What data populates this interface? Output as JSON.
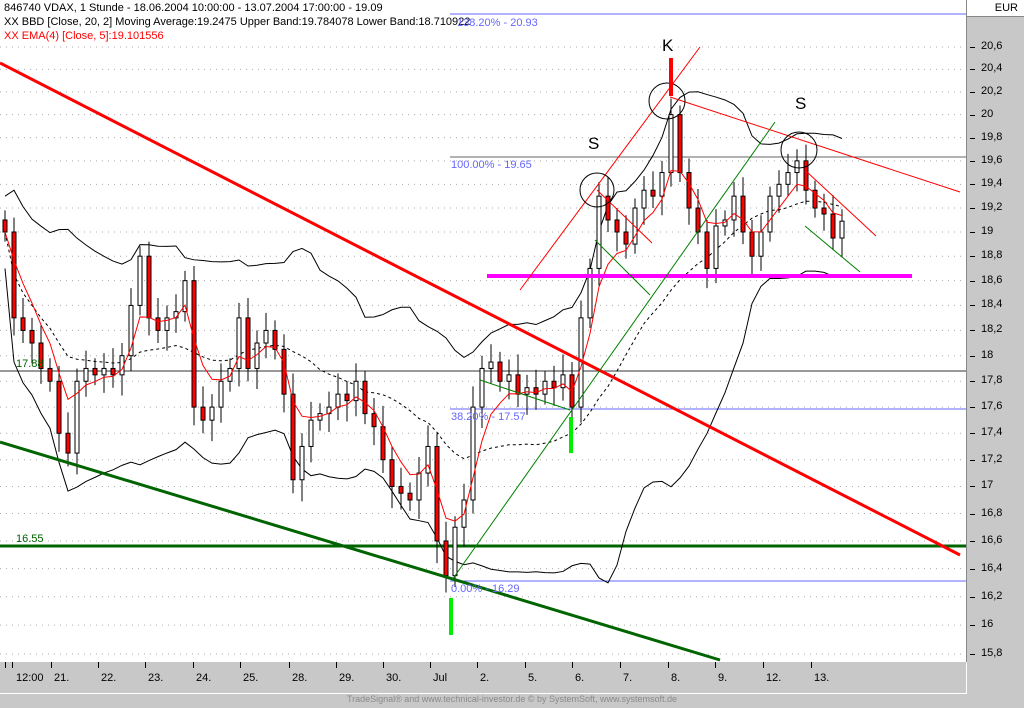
{
  "header": {
    "title_line": "846740  VDAX, 1 Stunde - 18.06.2004 10:00:00 - 13.07.2004 17:00:00 - 19.09",
    "bbd_line": "XX BBD [Close, 20, 2] Moving Average:19.2475 Upper Band:19.784078 Lower Band:18.710922",
    "ema_line": "XX EMA(4) [Close, 5]:19.101556"
  },
  "currency": "EUR",
  "footer": "TradeSignal® and www.technical-investor.de © by SystemSoft, www.systemsoft.de",
  "annotations": {
    "fib_138": "138.20% - 20.93",
    "fib_100": "100.00% - 19.65",
    "fib_38": "38.20% - 17.57",
    "fib_0": "0.00% - 16.29",
    "level_1788": "17.88",
    "level_1655": "16.55",
    "shoulder_left": "S",
    "head": "K",
    "shoulder_right": "S"
  },
  "colors": {
    "candle_down": "#ff0000",
    "candle_up": "#ffffff",
    "ema": "#ff0000",
    "trend_red": "#ff0000",
    "trend_green": "#006400",
    "neckline": "#ff00ff",
    "fib": "#6666ff",
    "marker_green": "#00ee00"
  },
  "chart_data": {
    "type": "candlestick",
    "title": "846740 VDAX, 1 Stunde",
    "scale": "log",
    "ylim": [
      15.75,
      20.75
    ],
    "yticks": [
      "20,6",
      "20,4",
      "20,2",
      "20",
      "19,8",
      "19,6",
      "19,4",
      "19,2",
      "19",
      "18,8",
      "18,6",
      "18,4",
      "18,2",
      "18",
      "17,8",
      "17,6",
      "17,4",
      "17,2",
      "17",
      "16,8",
      "16,6",
      "16,4",
      "16,2",
      "16",
      "15,8"
    ],
    "ytick_values": [
      20.6,
      20.4,
      20.2,
      20,
      19.8,
      19.6,
      19.4,
      19.2,
      19,
      18.8,
      18.6,
      18.4,
      18.2,
      18,
      17.8,
      17.6,
      17.4,
      17.2,
      17,
      16.8,
      16.6,
      16.4,
      16.2,
      16,
      15.8
    ],
    "xticks": [
      "12:00",
      "21.",
      "22.",
      "23.",
      "24.",
      "25.",
      "28.",
      "29.",
      "30.",
      "Jul",
      "2.",
      "5.",
      "6.",
      "7.",
      "8.",
      "9.",
      "12.",
      "13."
    ],
    "close": [
      19.0,
      18.3,
      18.2,
      18.1,
      17.9,
      17.8,
      17.4,
      17.25,
      17.8,
      17.9,
      17.85,
      17.9,
      17.85,
      18.0,
      18.4,
      18.8,
      18.3,
      18.2,
      18.3,
      18.35,
      18.6,
      17.6,
      17.5,
      17.6,
      17.8,
      17.9,
      18.3,
      17.9,
      18.1,
      18.2,
      18.05,
      17.7,
      17.05,
      17.3,
      17.5,
      17.55,
      17.6,
      17.7,
      17.65,
      17.8,
      17.55,
      17.45,
      17.2,
      17.0,
      16.95,
      16.9,
      17.1,
      17.3,
      16.6,
      16.35,
      16.7,
      16.9,
      17.6,
      17.9,
      17.95,
      17.8,
      17.85,
      17.7,
      17.75,
      17.7,
      17.8,
      17.75,
      17.85,
      17.6,
      18.3,
      18.7,
      19.3,
      19.1,
      19.0,
      18.9,
      19.2,
      19.35,
      19.3,
      19.5,
      20.0,
      19.5,
      19.2,
      19.0,
      18.7,
      19.05,
      19.1,
      19.3,
      19.0,
      18.8,
      19.0,
      19.3,
      19.4,
      19.5,
      19.6,
      19.35,
      19.2,
      19.15,
      18.95,
      19.09
    ],
    "indicators": {
      "bollinger": {
        "period": 20,
        "stddev": 2
      },
      "ema": {
        "period": 5
      }
    },
    "levels": {
      "fib_138": 20.93,
      "fib_100": 19.65,
      "fib_38": 17.57,
      "fib_0": 16.29,
      "support_green": 16.55,
      "line_black": 17.88,
      "neckline": 18.65
    }
  }
}
